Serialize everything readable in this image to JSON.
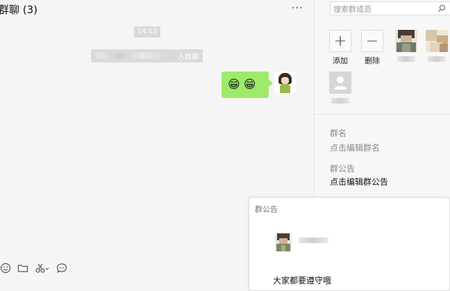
{
  "chat": {
    "title": "群聊 (3)",
    "more": "···",
    "time": "14:12",
    "system_msg_tail": "入群聊",
    "emojis": [
      "😁",
      "😁"
    ]
  },
  "panel": {
    "search_placeholder": "搜索群成员",
    "add_label": "添加",
    "remove_label": "删除",
    "group_name_label": "群名",
    "group_name_value": "点击编辑群名",
    "announcement_label": "群公告",
    "announcement_value": "点击编辑群公告"
  },
  "notice": {
    "title": "群公告",
    "text": "大家都要遵守哦"
  },
  "icons": {
    "toolbar": [
      "emoji-icon",
      "folder-icon",
      "scissors-icon",
      "chat-bubble-icon"
    ],
    "search": "search-icon",
    "add": "plus-icon",
    "remove": "minus-icon"
  },
  "colors": {
    "bubble": "#9eea6a",
    "background": "#f5f5f5",
    "time_pill": "#dadada"
  }
}
